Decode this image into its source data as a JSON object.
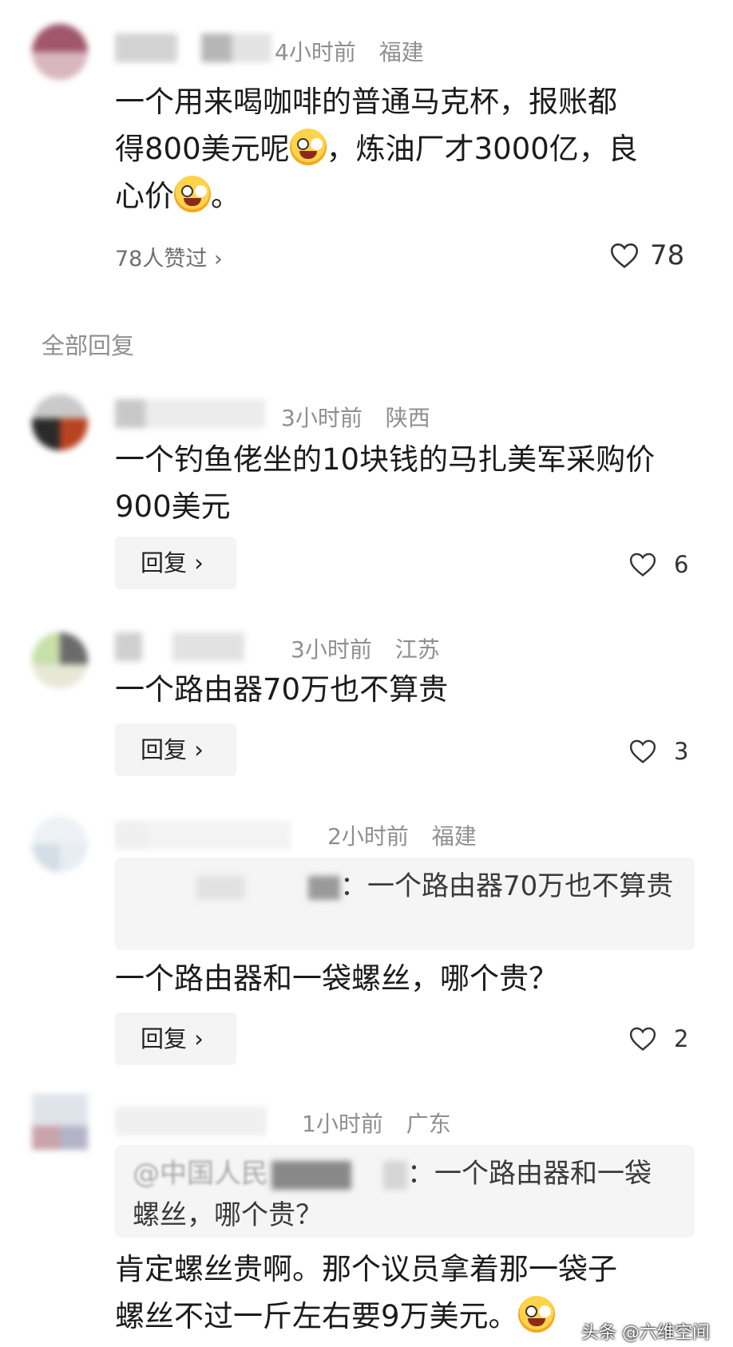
{
  "main_comment": {
    "time": "4小时前",
    "region": "福建",
    "text_1": "一个用来喝咖啡的普通马克杯，报账都",
    "text_2a": "得800美元呢",
    "text_2b": "，炼油厂才3000亿，良",
    "text_3a": "心价",
    "text_3b": "。",
    "liked_by": "78人赞过 ›",
    "like_count": "78"
  },
  "section_title": "全部回复",
  "replies": [
    {
      "time": "3小时前",
      "region": "陕西",
      "text": "一个钓鱼佬坐的10块钱的马扎美军采购价900美元",
      "reply_label": "回复 ›",
      "like_count": "6"
    },
    {
      "time": "3小时前",
      "region": "江苏",
      "text": "一个路由器70万也不算贵",
      "reply_label": "回复 ›",
      "like_count": "3"
    },
    {
      "time": "2小时前",
      "region": "福建",
      "quote": "：一个路由器70万也不算贵",
      "text": "一个路由器和一袋螺丝，哪个贵？",
      "reply_label": "回复 ›",
      "like_count": "2"
    },
    {
      "time": "1小时前",
      "region": "广东",
      "quote_prefix": "@中国人民",
      "quote": "：一个路由器和一袋螺丝，哪个贵？",
      "text_a": "肯定螺丝贵啊。那个议员拿着那一袋子",
      "text_b": "螺丝不过一斤左右要9万美元。"
    }
  ],
  "watermark": "头条 @六维空间",
  "icons": {
    "like": "heart-outline-icon",
    "emoji": "laughing-crying-emoji-icon"
  }
}
